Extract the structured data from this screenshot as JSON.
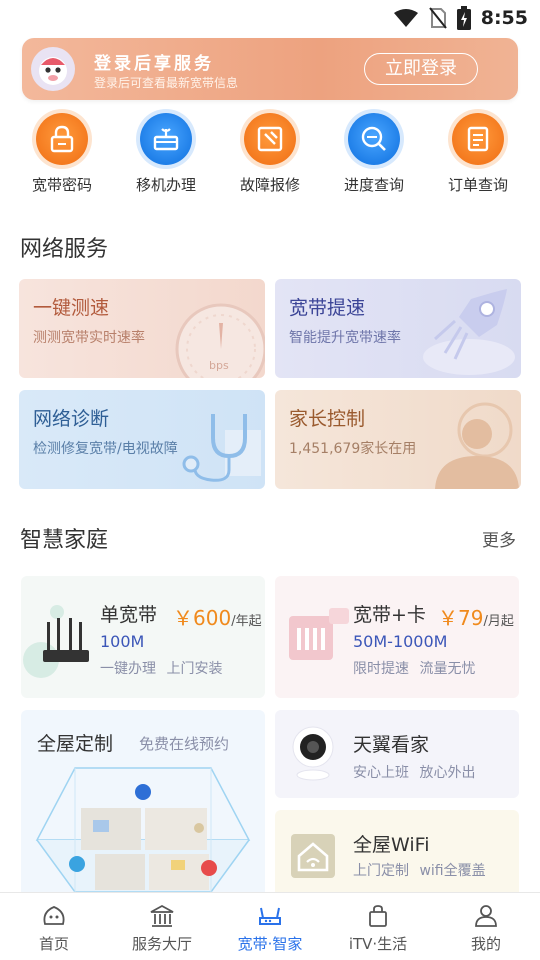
{
  "status_bar": {
    "time": "8:55",
    "icons": [
      "wifi-icon",
      "no-sim-icon",
      "battery-charging-icon"
    ]
  },
  "login_banner": {
    "title": "登录后享服务",
    "subtitle": "登录后可查看最新宽带信息",
    "button": "立即登录",
    "avatar": "mascot-avatar"
  },
  "quick_actions": [
    {
      "label": "宽带密码",
      "icon": "lock-icon",
      "color": "#f47a1f"
    },
    {
      "label": "移机办理",
      "icon": "move-box-icon",
      "color": "#1f7fe8"
    },
    {
      "label": "故障报修",
      "icon": "hammer-icon",
      "color": "#f47a1f"
    },
    {
      "label": "进度查询",
      "icon": "progress-search-icon",
      "color": "#1f7fe8"
    },
    {
      "label": "订单查询",
      "icon": "order-doc-icon",
      "color": "#f47a1f"
    }
  ],
  "network_services": {
    "title": "网络服务",
    "cards": [
      {
        "title": "一键测速",
        "subtitle": "测测宽带实时速率",
        "gauge_label": "bps",
        "icon": "speed-gauge-icon"
      },
      {
        "title": "宽带提速",
        "subtitle": "智能提升宽带速率",
        "icon": "rocket-icon"
      },
      {
        "title": "网络诊断",
        "subtitle": "检测修复宽带/电视故障",
        "icon": "stethoscope-icon"
      },
      {
        "title": "家长控制",
        "subtitle": "1,451,679家长在用",
        "icon": "parent-user-icon"
      }
    ]
  },
  "smart_home": {
    "title": "智慧家庭",
    "more": "更多",
    "broadband": {
      "title": "单宽带",
      "price": "￥600",
      "unit": "/年起",
      "speed": "100M",
      "desc": "一键办理 上门安装",
      "icon": "router-icon"
    },
    "bundle": {
      "title": "宽带+卡",
      "price": "￥79",
      "unit": "/月起",
      "speed": "50M-1000M",
      "desc": "限时提速 流量无忧",
      "icon": "sim-card-icon"
    },
    "custom": {
      "title": "全屋定制",
      "subtitle": "免费在线预约",
      "icon": "house-floorplan-icon"
    },
    "camera": {
      "title": "天翼看家",
      "desc": "安心上班 放心外出",
      "icon": "camera-icon"
    },
    "wifi": {
      "title": "全屋WiFi",
      "desc": "上门定制 wifi全覆盖",
      "icon": "home-wifi-icon"
    }
  },
  "bottom_nav": [
    {
      "label": "首页",
      "icon": "home-mascot-icon",
      "active": false
    },
    {
      "label": "服务大厅",
      "icon": "hall-icon",
      "active": false
    },
    {
      "label": "宽带·智家",
      "icon": "router-nav-icon",
      "active": true
    },
    {
      "label": "iTV·生活",
      "icon": "shopping-bag-icon",
      "active": false
    },
    {
      "label": "我的",
      "icon": "user-icon",
      "active": false
    }
  ]
}
